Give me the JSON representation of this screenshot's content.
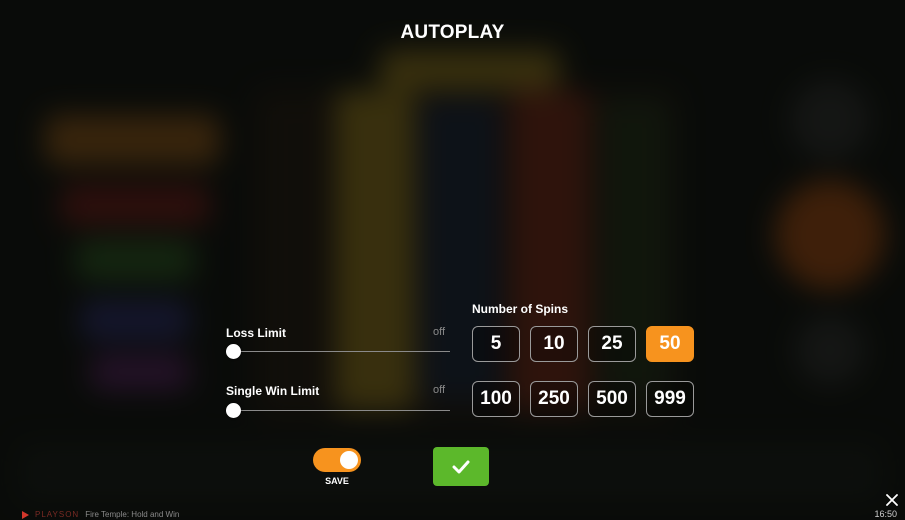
{
  "title": "AUTOPLAY",
  "limits": {
    "loss": {
      "label": "Loss Limit",
      "state": "off",
      "level": 0
    },
    "single_win": {
      "label": "Single Win Limit",
      "state": "off",
      "level": 0
    }
  },
  "spins": {
    "label": "Number of Spins",
    "options": [
      "5",
      "10",
      "25",
      "50",
      "100",
      "250",
      "500",
      "999"
    ],
    "selected": "50"
  },
  "save": {
    "label": "SAVE",
    "on": true
  },
  "footer": {
    "brand": "PLAYSON",
    "game": "Fire Temple: Hold and Win",
    "time": "16:50"
  },
  "icons": {
    "confirm": "checkmark-icon",
    "close": "close-icon",
    "brand": "playson-logo-icon"
  },
  "colors": {
    "accent": "#f7931e",
    "confirm": "#5cb82b"
  }
}
